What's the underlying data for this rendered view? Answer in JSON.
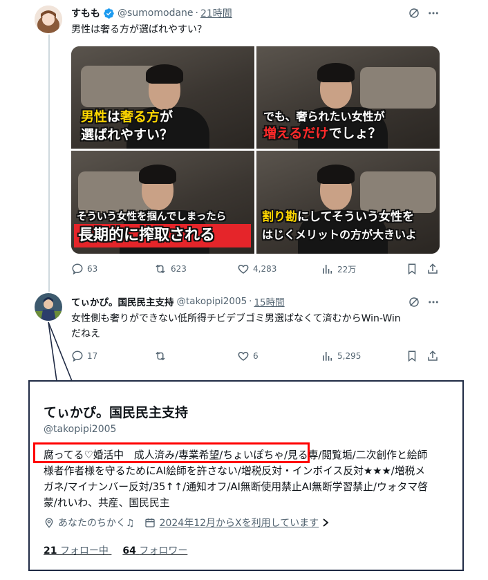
{
  "tweet1": {
    "display_name": "すもも",
    "handle": "@sumomodane",
    "separator": "·",
    "time": "21時間",
    "text": "男性は奢る方が選ばれやすい？",
    "images": [
      {
        "line1_a": "男性",
        "line1_b": "は",
        "line1_c": "奢る方",
        "line1_d": "が",
        "line2": "選ばれやすい？"
      },
      {
        "line1": "でも、奢られたい女性が",
        "line2_a": "増えるだけ",
        "line2_b": "でしょ？"
      },
      {
        "line1": "そういう女性を掴んでしまったら",
        "line2": "長期的に搾取される"
      },
      {
        "line1_a": "割り勘",
        "line1_b": "にしてそういう女性を",
        "line2": "はじくメリットの方が大きいよ"
      }
    ],
    "reply_count": "63",
    "retweet_count": "623",
    "like_count": "4,283",
    "view_count": "22万"
  },
  "tweet2": {
    "display_name": "てぃかぴ。国民民主支持",
    "handle": "@takopipi2005",
    "separator": "·",
    "time": "15時間",
    "text_line1": "女性側も奢りができない低所得チビデブゴミ男選ばなくて済むからWin-Win",
    "text_line2": "だねえ",
    "reply_count": "17",
    "retweet_count": "",
    "like_count": "6",
    "view_count": "5,295"
  },
  "profile_card": {
    "display_name": "てぃかぴ。国民民主支持",
    "handle": "@takopipi2005",
    "bio_lines": [
      "腐ってる♡婚活中　成人済み/専業希望/ちょいぽちゃ/見る専/閲覧垢/二次創作と絵師",
      "様者作者様を守るためにAI絵師を許さない/増税反対・インボイス反対★★★/増税メ",
      "ガネ/マイナンバー反対/35↑↑/通知オフ/AI無断使用禁止AI無断学習禁止/ウォタマ啓",
      "蒙/れいわ、共産、国民民主"
    ],
    "location": "あなたのちかく♫",
    "joined": "2024年12月からXを利用しています",
    "following_count": "21",
    "following_label": "フォロー中",
    "followers_count": "64",
    "followers_label": "フォロワー"
  },
  "colors": {
    "text": "#0f1419",
    "muted": "#536471",
    "verified": "#1d9bf0",
    "highlight_box": "#ff0000",
    "card_border": "#1f2a44"
  }
}
